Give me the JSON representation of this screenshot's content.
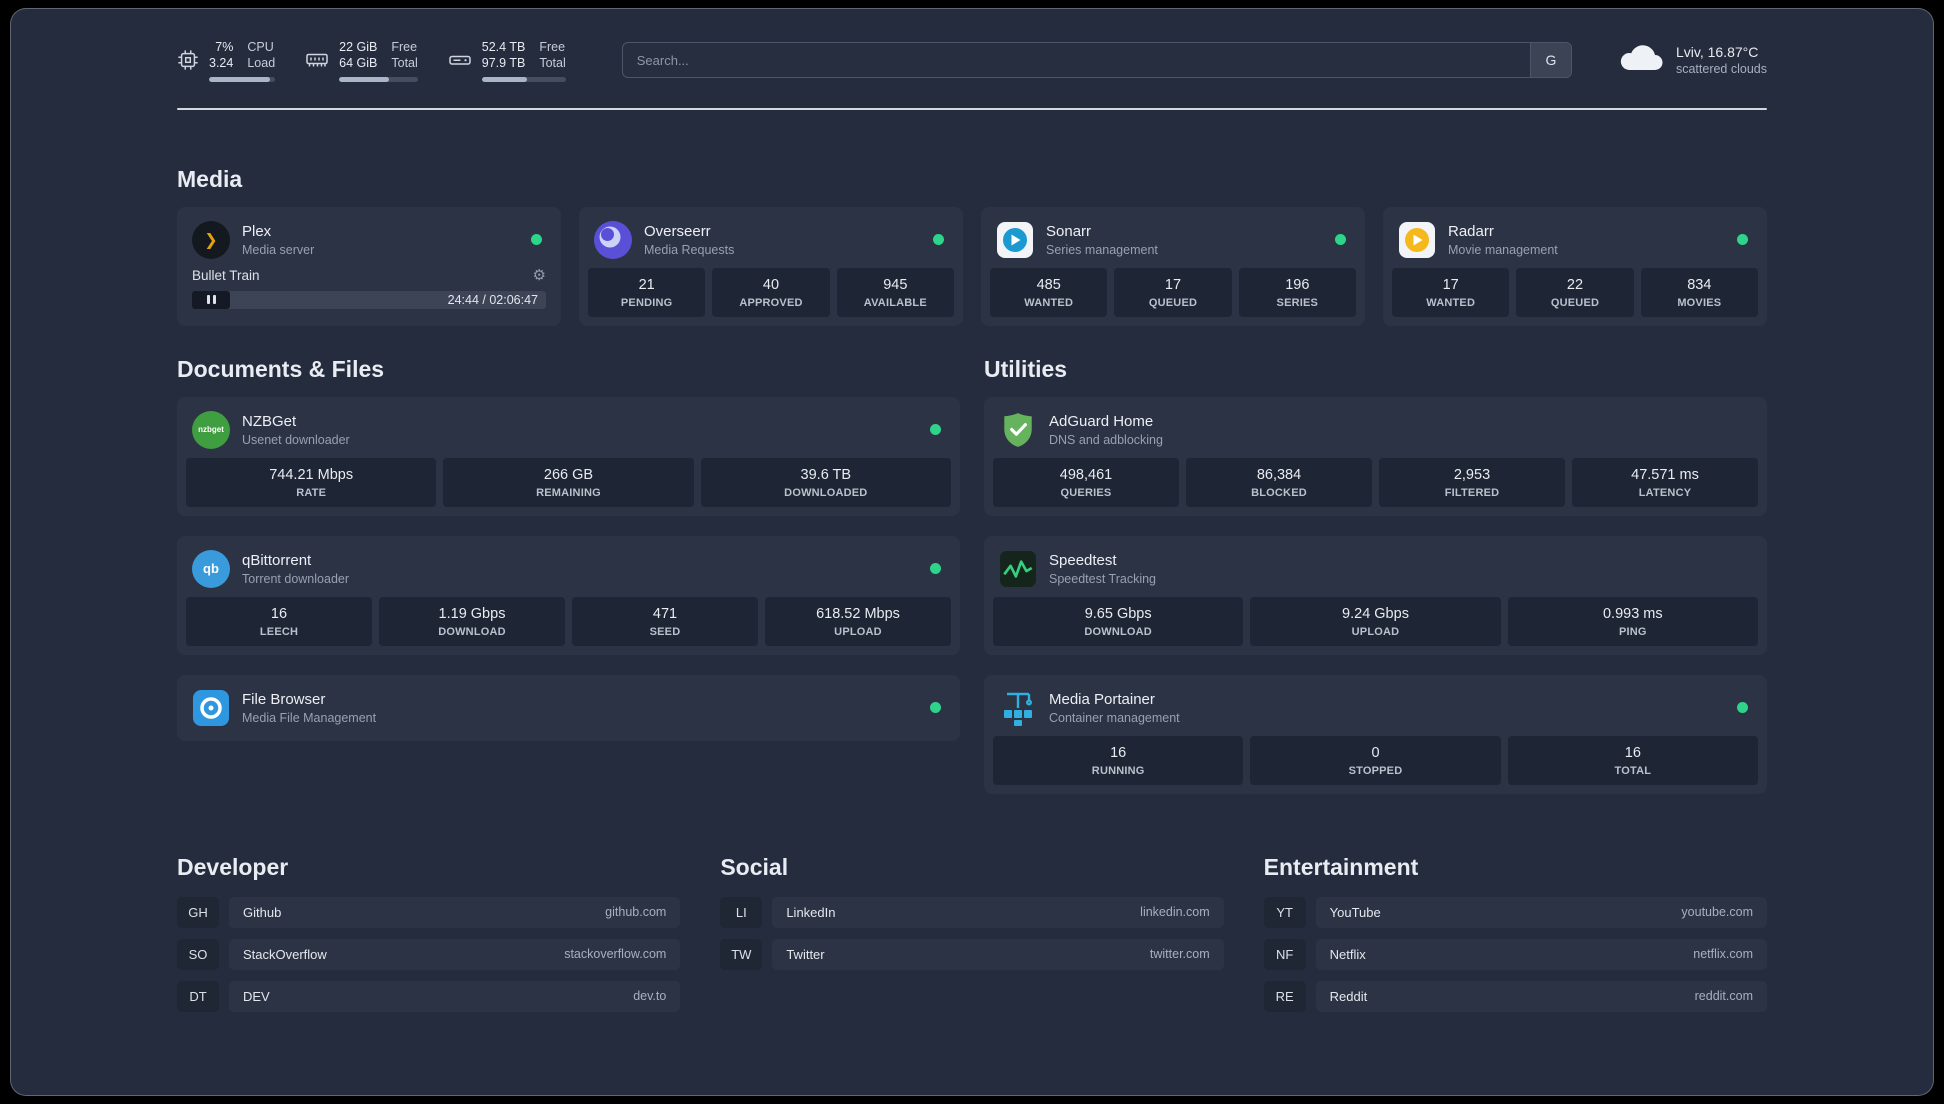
{
  "topbar": {
    "cpu": {
      "values": [
        "7%",
        "3.24"
      ],
      "labels": [
        "CPU",
        "Load"
      ],
      "bar_percent": 92
    },
    "memory": {
      "values": [
        "22 GiB",
        "64 GiB"
      ],
      "labels": [
        "Free",
        "Total"
      ],
      "bar_percent": 64
    },
    "disk": {
      "values": [
        "52.4 TB",
        "97.9 TB"
      ],
      "labels": [
        "Free",
        "Total"
      ],
      "bar_percent": 54
    },
    "search": {
      "placeholder": "Search...",
      "provider_label": "G"
    },
    "weather": {
      "location": "Lviv, 16.87°C",
      "condition": "scattered clouds"
    }
  },
  "icons": {
    "plex_glyph": "❯",
    "nzbget_text": "nzbget",
    "qb_text": "qb",
    "gear_glyph": "⚙"
  },
  "media": {
    "title": "Media",
    "plex": {
      "name": "Plex",
      "subtitle": "Media server",
      "now_playing": "Bullet Train",
      "time": "24:44 / 02:06:47"
    },
    "overseerr": {
      "name": "Overseerr",
      "subtitle": "Media Requests",
      "stats": [
        {
          "value": "21",
          "label": "PENDING"
        },
        {
          "value": "40",
          "label": "APPROVED"
        },
        {
          "value": "945",
          "label": "AVAILABLE"
        }
      ]
    },
    "sonarr": {
      "name": "Sonarr",
      "subtitle": "Series management",
      "stats": [
        {
          "value": "485",
          "label": "WANTED"
        },
        {
          "value": "17",
          "label": "QUEUED"
        },
        {
          "value": "196",
          "label": "SERIES"
        }
      ]
    },
    "radarr": {
      "name": "Radarr",
      "subtitle": "Movie management",
      "stats": [
        {
          "value": "17",
          "label": "WANTED"
        },
        {
          "value": "22",
          "label": "QUEUED"
        },
        {
          "value": "834",
          "label": "MOVIES"
        }
      ]
    }
  },
  "documents": {
    "title": "Documents & Files",
    "nzbget": {
      "name": "NZBGet",
      "subtitle": "Usenet downloader",
      "stats": [
        {
          "value": "744.21 Mbps",
          "label": "RATE"
        },
        {
          "value": "266 GB",
          "label": "REMAINING"
        },
        {
          "value": "39.6 TB",
          "label": "DOWNLOADED"
        }
      ]
    },
    "qbittorrent": {
      "name": "qBittorrent",
      "subtitle": "Torrent downloader",
      "stats": [
        {
          "value": "16",
          "label": "LEECH"
        },
        {
          "value": "1.19 Gbps",
          "label": "DOWNLOAD"
        },
        {
          "value": "471",
          "label": "SEED"
        },
        {
          "value": "618.52 Mbps",
          "label": "UPLOAD"
        }
      ]
    },
    "filebrowser": {
      "name": "File Browser",
      "subtitle": "Media File Management"
    }
  },
  "utilities": {
    "title": "Utilities",
    "adguard": {
      "name": "AdGuard Home",
      "subtitle": "DNS and adblocking",
      "stats": [
        {
          "value": "498,461",
          "label": "QUERIES"
        },
        {
          "value": "86,384",
          "label": "BLOCKED"
        },
        {
          "value": "2,953",
          "label": "FILTERED"
        },
        {
          "value": "47.571 ms",
          "label": "LATENCY"
        }
      ]
    },
    "speedtest": {
      "name": "Speedtest",
      "subtitle": "Speedtest Tracking",
      "stats": [
        {
          "value": "9.65 Gbps",
          "label": "DOWNLOAD"
        },
        {
          "value": "9.24 Gbps",
          "label": "UPLOAD"
        },
        {
          "value": "0.993 ms",
          "label": "PING"
        }
      ]
    },
    "portainer": {
      "name": "Media Portainer",
      "subtitle": "Container management",
      "stats": [
        {
          "value": "16",
          "label": "RUNNING"
        },
        {
          "value": "0",
          "label": "STOPPED"
        },
        {
          "value": "16",
          "label": "TOTAL"
        }
      ]
    }
  },
  "bookmarks": [
    {
      "title": "Developer",
      "items": [
        {
          "abbr": "GH",
          "name": "Github",
          "domain": "github.com"
        },
        {
          "abbr": "SO",
          "name": "StackOverflow",
          "domain": "stackoverflow.com"
        },
        {
          "abbr": "DT",
          "name": "DEV",
          "domain": "dev.to"
        }
      ]
    },
    {
      "title": "Social",
      "items": [
        {
          "abbr": "LI",
          "name": "LinkedIn",
          "domain": "linkedin.com"
        },
        {
          "abbr": "TW",
          "name": "Twitter",
          "domain": "twitter.com"
        }
      ]
    },
    {
      "title": "Entertainment",
      "items": [
        {
          "abbr": "YT",
          "name": "YouTube",
          "domain": "youtube.com"
        },
        {
          "abbr": "NF",
          "name": "Netflix",
          "domain": "netflix.com"
        },
        {
          "abbr": "RE",
          "name": "Reddit",
          "domain": "reddit.com"
        }
      ]
    }
  ],
  "colors": {
    "background": "#252c3d",
    "card": "#2c3344",
    "tile": "#1e2534",
    "status_online": "#2ed48a",
    "plex_accent": "#e5a00d"
  }
}
